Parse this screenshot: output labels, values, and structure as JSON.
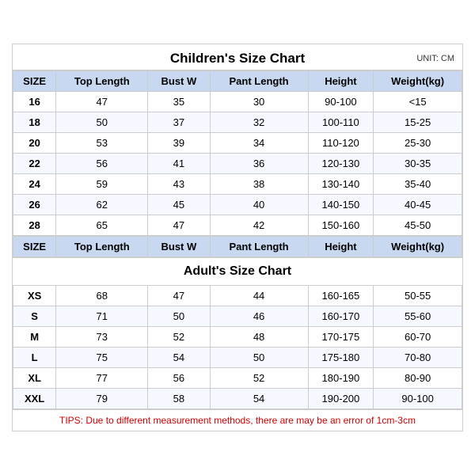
{
  "title": "Children's Size Chart",
  "unit": "UNIT: CM",
  "children_headers": [
    "SIZE",
    "Top Length",
    "Bust W",
    "Pant Length",
    "Height",
    "Weight(kg)"
  ],
  "children_rows": [
    [
      "16",
      "47",
      "35",
      "30",
      "90-100",
      "<15"
    ],
    [
      "18",
      "50",
      "37",
      "32",
      "100-110",
      "15-25"
    ],
    [
      "20",
      "53",
      "39",
      "34",
      "110-120",
      "25-30"
    ],
    [
      "22",
      "56",
      "41",
      "36",
      "120-130",
      "30-35"
    ],
    [
      "24",
      "59",
      "43",
      "38",
      "130-140",
      "35-40"
    ],
    [
      "26",
      "62",
      "45",
      "40",
      "140-150",
      "40-45"
    ],
    [
      "28",
      "65",
      "47",
      "42",
      "150-160",
      "45-50"
    ]
  ],
  "adult_title": "Adult's Size Chart",
  "adult_headers": [
    "SIZE",
    "Top Length",
    "Bust W",
    "Pant Length",
    "Height",
    "Weight(kg)"
  ],
  "adult_rows": [
    [
      "XS",
      "68",
      "47",
      "44",
      "160-165",
      "50-55"
    ],
    [
      "S",
      "71",
      "50",
      "46",
      "160-170",
      "55-60"
    ],
    [
      "M",
      "73",
      "52",
      "48",
      "170-175",
      "60-70"
    ],
    [
      "L",
      "75",
      "54",
      "50",
      "175-180",
      "70-80"
    ],
    [
      "XL",
      "77",
      "56",
      "52",
      "180-190",
      "80-90"
    ],
    [
      "XXL",
      "79",
      "58",
      "54",
      "190-200",
      "90-100"
    ]
  ],
  "tips": "TIPS: Due to different measurement methods, there are may be an error of 1cm-3cm"
}
